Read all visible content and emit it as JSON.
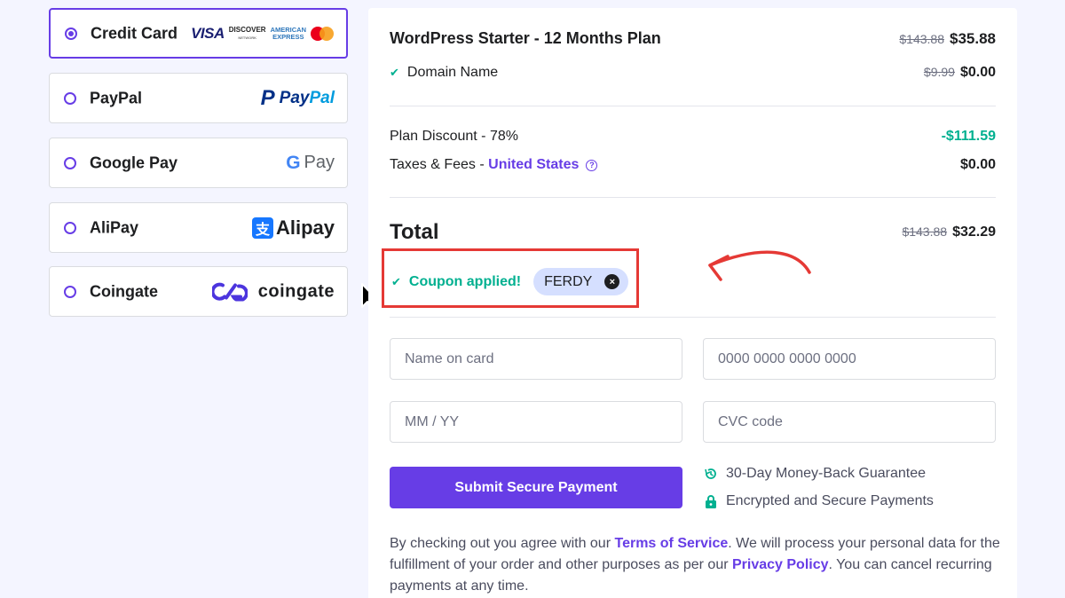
{
  "payment_methods": [
    {
      "label": "Credit Card",
      "selected": true,
      "logos": {
        "visa": "VISA",
        "discover": "DISCOVER",
        "discover_sub": "NETWORK",
        "amex_top": "AMERICAN",
        "amex_bottom": "EXPRESS"
      }
    },
    {
      "label": "PayPal",
      "selected": false,
      "logo_text_a": "Pay",
      "logo_text_b": "Pal",
      "logo_mark": "P"
    },
    {
      "label": "Google Pay",
      "selected": false,
      "logo_mark": "G",
      "logo_text": "Pay"
    },
    {
      "label": "AliPay",
      "selected": false,
      "logo_mark": "支",
      "logo_text": "Alipay"
    },
    {
      "label": "Coingate",
      "selected": false,
      "logo_mark": "CG",
      "logo_text": "coingate"
    }
  ],
  "order": {
    "plan_name": "WordPress Starter - 12 Months Plan",
    "plan_old_price": "$143.88",
    "plan_price": "$35.88",
    "domain_label": "Domain Name",
    "domain_old_price": "$9.99",
    "domain_price": "$0.00",
    "discount_label": "Plan Discount - 78%",
    "discount_value": "-$111.59",
    "taxes_label": "Taxes & Fees - ",
    "taxes_country": "United States",
    "taxes_help": "?",
    "taxes_value": "$0.00",
    "total_label": "Total",
    "total_old_price": "$143.88",
    "total_price": "$32.29"
  },
  "coupon": {
    "status": "Coupon applied!",
    "code": "FERDY",
    "remove_icon": "×"
  },
  "form": {
    "name_placeholder": "Name on card",
    "card_placeholder": "0000 0000 0000 0000",
    "expiry_placeholder": "MM / YY",
    "cvc_placeholder": "CVC code",
    "submit_label": "Submit Secure Payment"
  },
  "assurances": [
    {
      "icon": "history-icon",
      "text": "30-Day Money-Back Guarantee"
    },
    {
      "icon": "lock-icon",
      "text": "Encrypted and Secure Payments"
    }
  ],
  "legal": {
    "part1": "By checking out you agree with our ",
    "tos": "Terms of Service",
    "part2": ". We will process your personal data for the fulfillment of your order and other purposes as per our ",
    "privacy": "Privacy Policy",
    "part3": ". You can cancel recurring payments at any time."
  },
  "colors": {
    "brand": "#673de6",
    "success": "#00b090",
    "annotation": "#e53935",
    "coupon_chip": "#d5dfff"
  }
}
